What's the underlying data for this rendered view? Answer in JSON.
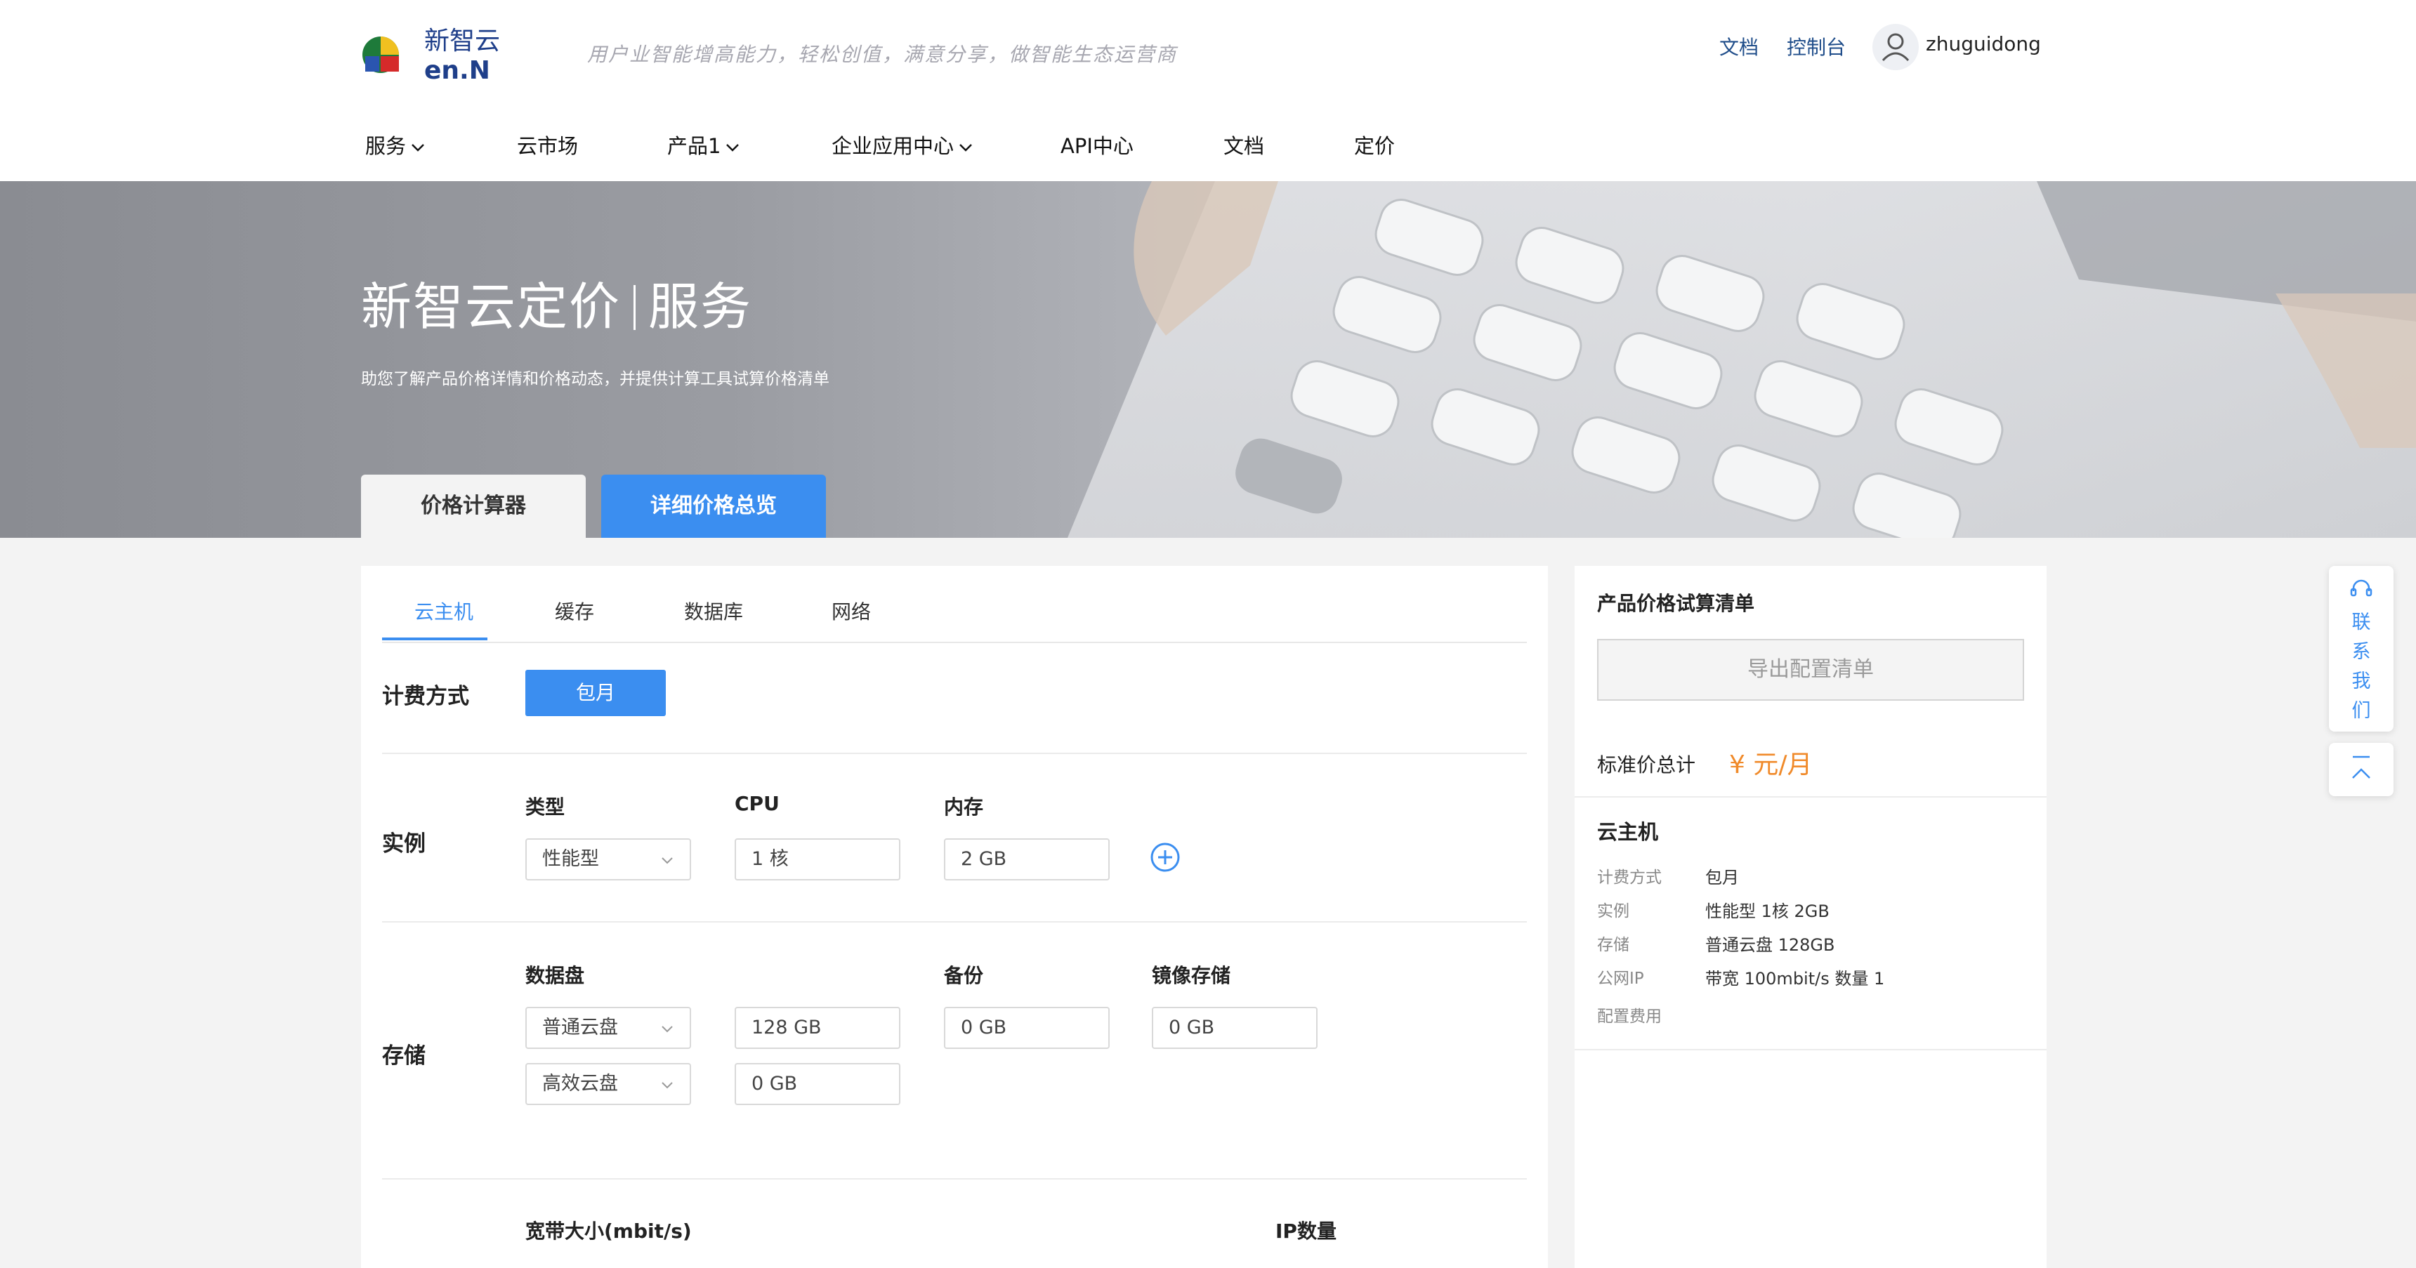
{
  "header": {
    "logo_text": "新智云",
    "logo_sub": "en.N",
    "slogan": "用户业智能增高能力，轻松创值，满意分享，做智能生态运营商",
    "links": {
      "docs": "文档",
      "console": "控制台"
    },
    "username": "zhuguidong"
  },
  "nav": [
    {
      "label": "服务",
      "dropdown": true
    },
    {
      "label": "云市场",
      "dropdown": false
    },
    {
      "label": "产品1",
      "dropdown": true
    },
    {
      "label": "企业应用中心",
      "dropdown": true
    },
    {
      "label": "API中心",
      "dropdown": false
    },
    {
      "label": "文档",
      "dropdown": false
    },
    {
      "label": "定价",
      "dropdown": false
    }
  ],
  "banner": {
    "title_a": "新智云定价",
    "title_b": "服务",
    "subtitle": "助您了解产品价格详情和价格动态，并提供计算工具试算价格清单",
    "tab_calc": "价格计算器",
    "tab_detail": "详细价格总览"
  },
  "calculator": {
    "subtabs": [
      "云主机",
      "缓存",
      "数据库",
      "网络"
    ],
    "billing": {
      "label": "计费方式",
      "option": "包月"
    },
    "instance": {
      "label": "实例",
      "type_label": "类型",
      "type_value": "性能型",
      "cpu_label": "CPU",
      "cpu_value": "1 核",
      "mem_label": "内存",
      "mem_value": "2 GB"
    },
    "storage": {
      "label": "存储",
      "disk_label": "数据盘",
      "disks": [
        {
          "type": "普通云盘",
          "size": "128 GB"
        },
        {
          "type": "高效云盘",
          "size": "0 GB"
        }
      ],
      "backup_label": "备份",
      "backup_value": "0 GB",
      "image_label": "镜像存储",
      "image_value": "0 GB"
    },
    "network": {
      "bandwidth_label": "宽带大小(mbit/s)",
      "ip_label": "IP数量"
    }
  },
  "summary": {
    "title": "产品价格试算清单",
    "export_button": "导出配置清单",
    "total_label": "标准价总计",
    "total_value": "¥ 元/月",
    "section": "云主机",
    "items": [
      {
        "k": "计费方式",
        "v": "包月"
      },
      {
        "k": "实例",
        "v": "性能型 1核  2GB"
      },
      {
        "k": "存储",
        "v": "普通云盘 128GB"
      },
      {
        "k": "公网IP",
        "v": "带宽 100mbit/s 数量 1"
      },
      {
        "k": "配置费用",
        "v": ""
      }
    ]
  },
  "float": {
    "contact": [
      "联",
      "系",
      "我",
      "们"
    ],
    "to_top": "TOP"
  },
  "colors": {
    "accent": "#3b8ef0",
    "price": "#f08a2a",
    "nav_link": "#1f4d8a"
  }
}
